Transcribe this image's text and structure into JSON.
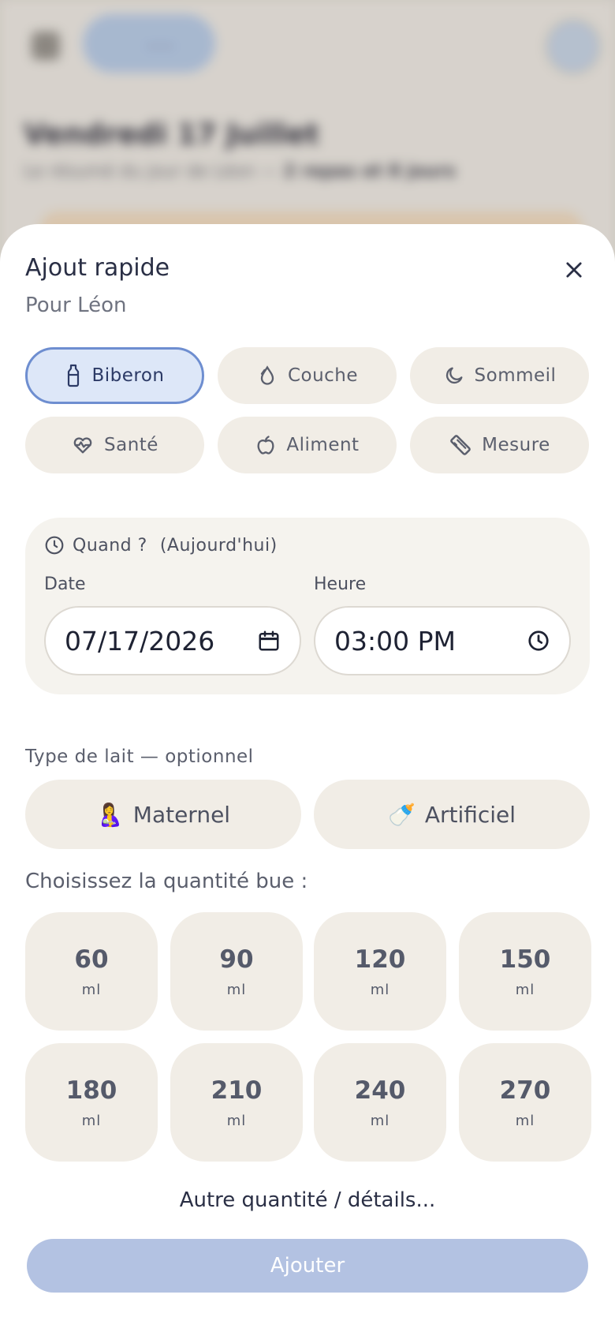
{
  "background": {
    "page_title": "Vendredi 17 Juillet",
    "page_subtitle": "Le résumé du jour de Léon —",
    "page_subtitle_strong": "2 repas et 8 jours"
  },
  "sheet": {
    "title": "Ajout rapide",
    "subtitle": "Pour Léon",
    "close_icon": "close-icon"
  },
  "categories": [
    {
      "label": "Biberon",
      "icon": "bottle-icon",
      "active": true
    },
    {
      "label": "Couche",
      "icon": "drop-icon",
      "active": false
    },
    {
      "label": "Sommeil",
      "icon": "moon-icon",
      "active": false
    },
    {
      "label": "Santé",
      "icon": "heart-pulse-icon",
      "active": false
    },
    {
      "label": "Aliment",
      "icon": "apple-icon",
      "active": false
    },
    {
      "label": "Mesure",
      "icon": "ruler-icon",
      "active": false
    }
  ],
  "when": {
    "label": "Quand ?",
    "hint": "(Aujourd'hui)",
    "date_label": "Date",
    "date_value": "07/17/2026",
    "time_label": "Heure",
    "time_value": "03:00 PM"
  },
  "milk": {
    "label": "Type de lait — optionnel",
    "options": [
      {
        "emoji": "🤱",
        "label": "Maternel"
      },
      {
        "emoji": "🍼",
        "label": "Artificiel"
      }
    ]
  },
  "quantity": {
    "label": "Choisissez la quantité bue :",
    "unit": "ml",
    "options": [
      "60",
      "90",
      "120",
      "150",
      "180",
      "210",
      "240",
      "270"
    ]
  },
  "other_label": "Autre quantité / détails...",
  "submit_label": "Ajouter",
  "colors": {
    "accent": "#6e8ed0",
    "chip_bg": "#f1ede6",
    "submit_disabled": "#b3c2e2"
  }
}
